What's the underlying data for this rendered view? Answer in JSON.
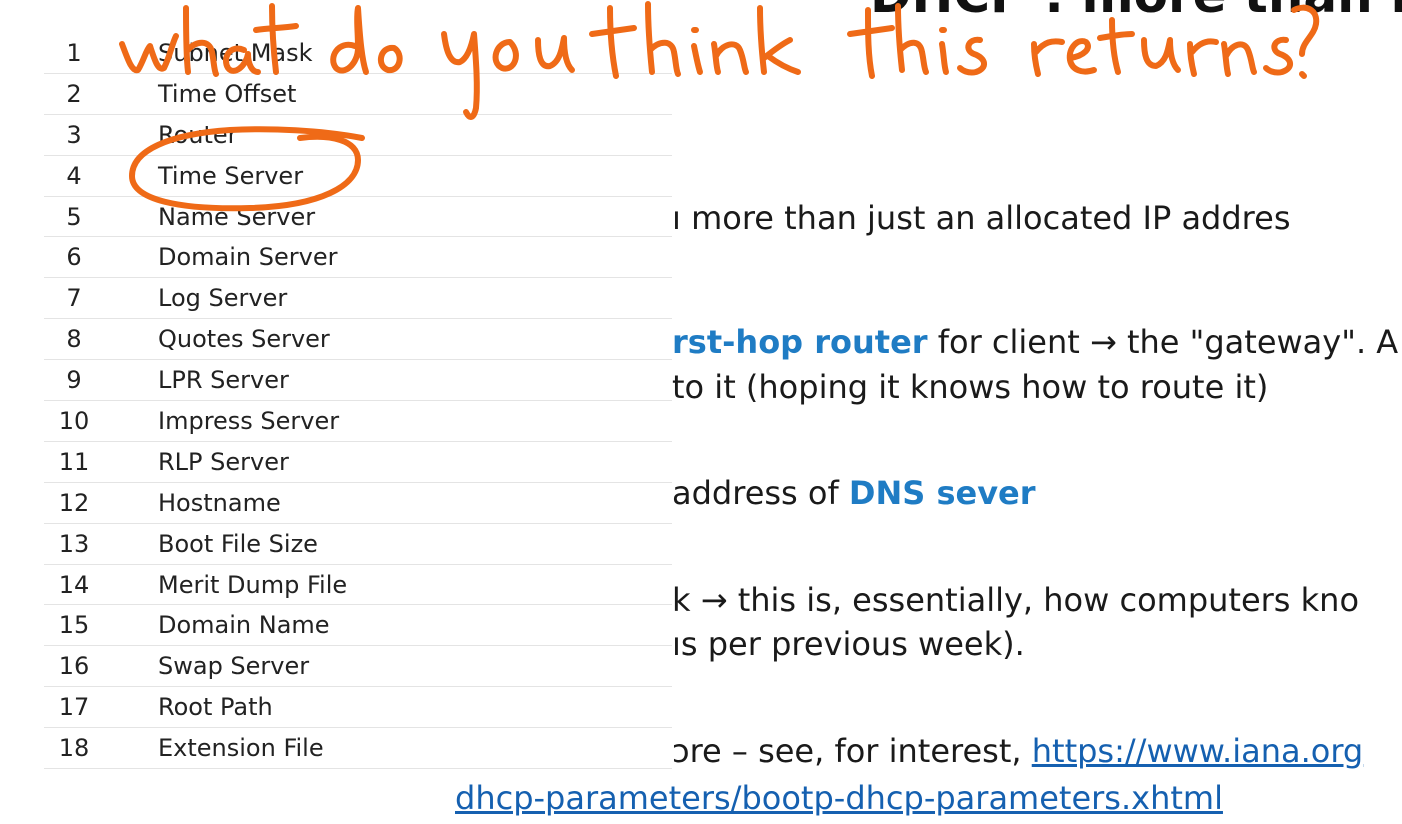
{
  "slide": {
    "title": "DHCP : more than I",
    "lines": [
      "ı more than just an allocated IP addres",
      "rst-hop router",
      " for client → the \"gateway\". A",
      "to it (hoping it knows how to route it)",
      "address of ",
      "DNS sever",
      "k → this is, essentially, how computers kno",
      "ıs per previous week).",
      "ɔre – see, for interest, ",
      "https://www.iana.org",
      "dhcp-parameters/bootp-dhcp-parameters.xhtml"
    ]
  },
  "options_table": {
    "rows": [
      {
        "num": "1",
        "name": "Subnet Mask"
      },
      {
        "num": "2",
        "name": "Time Offset"
      },
      {
        "num": "3",
        "name": "Router"
      },
      {
        "num": "4",
        "name": "Time Server"
      },
      {
        "num": "5",
        "name": "Name Server"
      },
      {
        "num": "6",
        "name": "Domain Server"
      },
      {
        "num": "7",
        "name": "Log Server"
      },
      {
        "num": "8",
        "name": "Quotes Server"
      },
      {
        "num": "9",
        "name": "LPR Server"
      },
      {
        "num": "10",
        "name": "Impress Server"
      },
      {
        "num": "11",
        "name": "RLP Server"
      },
      {
        "num": "12",
        "name": "Hostname"
      },
      {
        "num": "13",
        "name": "Boot File Size"
      },
      {
        "num": "14",
        "name": "Merit Dump File"
      },
      {
        "num": "15",
        "name": "Domain Name"
      },
      {
        "num": "16",
        "name": "Swap Server"
      },
      {
        "num": "17",
        "name": "Root Path"
      },
      {
        "num": "18",
        "name": "Extension File"
      }
    ]
  },
  "annotation": {
    "handwritten_text": "what do you think this returns?",
    "circled_item": "Time Server",
    "ink_color": "#ef6a17"
  },
  "colors": {
    "highlight": "#1f7cc4",
    "link": "#1560b0"
  }
}
